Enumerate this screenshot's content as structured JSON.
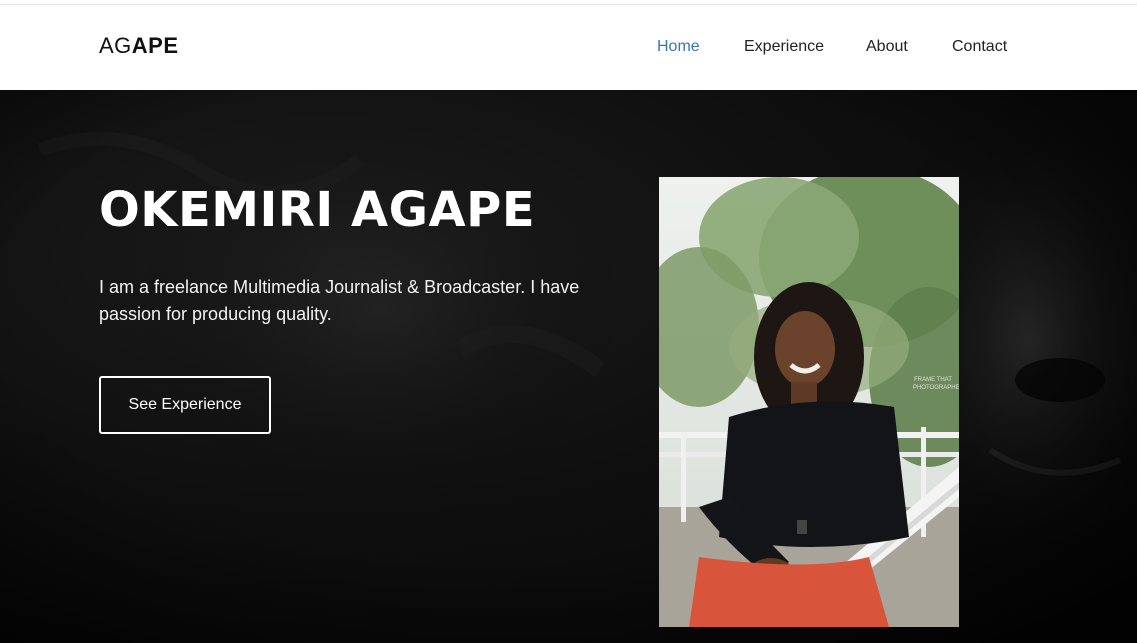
{
  "header": {
    "logo": {
      "light": "AG",
      "bold": "APE"
    },
    "nav": [
      {
        "label": "Home",
        "active": true
      },
      {
        "label": "Experience",
        "active": false
      },
      {
        "label": "About",
        "active": false
      },
      {
        "label": "Contact",
        "active": false
      }
    ]
  },
  "hero": {
    "title": "OKEMIRI AGAPE",
    "description": "I am a freelance Multimedia Journalist & Broadcaster. I have passion for producing quality.",
    "cta_label": "See Experience",
    "photo_watermark": "FRAME THAT PHOTOGRAPHER"
  },
  "colors": {
    "nav_active": "#3a76b0",
    "nav_text": "#222222",
    "hero_background": "#0b0b0b",
    "hero_text": "#ffffff"
  }
}
